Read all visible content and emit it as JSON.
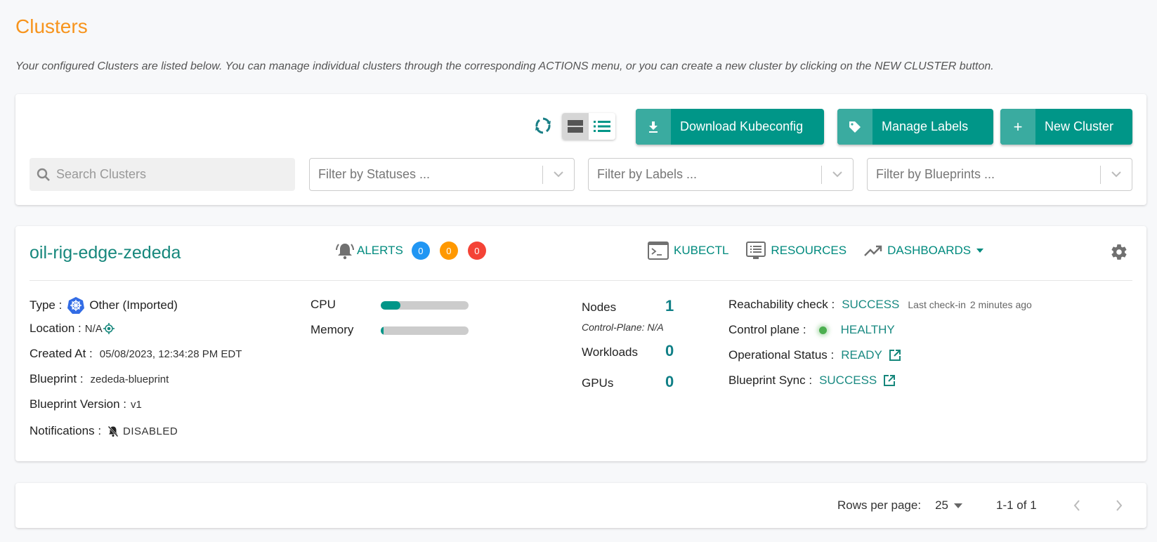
{
  "page": {
    "title": "Clusters",
    "description": "Your configured Clusters are listed below. You can manage individual clusters through the corresponding ACTIONS menu, or you can create a new cluster by clicking on the NEW CLUSTER button."
  },
  "toolbar": {
    "refresh_icon": "refresh-icon",
    "view_modes": [
      "card-view",
      "list-view"
    ],
    "active_view": "card-view",
    "buttons": {
      "download": "Download Kubeconfig",
      "labels": "Manage Labels",
      "new": "New Cluster"
    },
    "search_placeholder": "Search Clusters",
    "filters": {
      "statuses": "Filter by Statuses ...",
      "labels": "Filter by Labels ...",
      "blueprints": "Filter by Blueprints ..."
    }
  },
  "cluster": {
    "name": "oil-rig-edge-zededa",
    "alerts": {
      "label": "ALERTS",
      "counts": [
        {
          "level": "info",
          "value": "0",
          "color": "#2196f3"
        },
        {
          "level": "warning",
          "value": "0",
          "color": "#ff9800"
        },
        {
          "level": "critical",
          "value": "0",
          "color": "#f44336"
        }
      ]
    },
    "links": {
      "kubectl": "KUBECTL",
      "resources": "RESOURCES",
      "dashboards": "DASHBOARDS"
    },
    "details": {
      "type_label": "Type :",
      "type_value": "Other (Imported)",
      "location_label": "Location :",
      "location_value": "N/A",
      "created_label": "Created At :",
      "created_value": "05/08/2023, 12:34:28 PM EDT",
      "blueprint_label": "Blueprint :",
      "blueprint_value": "zededa-blueprint",
      "bp_version_label": "Blueprint Version :",
      "bp_version_value": "v1",
      "notifications_label": "Notifications :",
      "notifications_value": "DISABLED"
    },
    "resources": {
      "cpu_label": "CPU",
      "cpu_usage_percent": 22,
      "memory_label": "Memory",
      "memory_usage_percent": 3
    },
    "stats": {
      "nodes_label": "Nodes",
      "nodes_value": "1",
      "control_plane_note": "Control-Plane: N/A",
      "workloads_label": "Workloads",
      "workloads_value": "0",
      "gpus_label": "GPUs",
      "gpus_value": "0"
    },
    "status": {
      "reachability_label": "Reachability check :",
      "reachability_value": "SUCCESS",
      "last_checkin_label": "Last check-in",
      "last_checkin_value": "2 minutes ago",
      "control_plane_label": "Control plane :",
      "control_plane_value": "HEALTHY",
      "operational_label": "Operational Status :",
      "operational_value": "READY",
      "bp_sync_label": "Blueprint Sync :",
      "bp_sync_value": "SUCCESS"
    }
  },
  "pagination": {
    "rows_per_page_label": "Rows per page:",
    "rows_per_page_value": "25",
    "range": "1-1 of 1"
  },
  "colors": {
    "accent": "#009688",
    "title": "#f7941d",
    "healthy": "#4caf50"
  }
}
